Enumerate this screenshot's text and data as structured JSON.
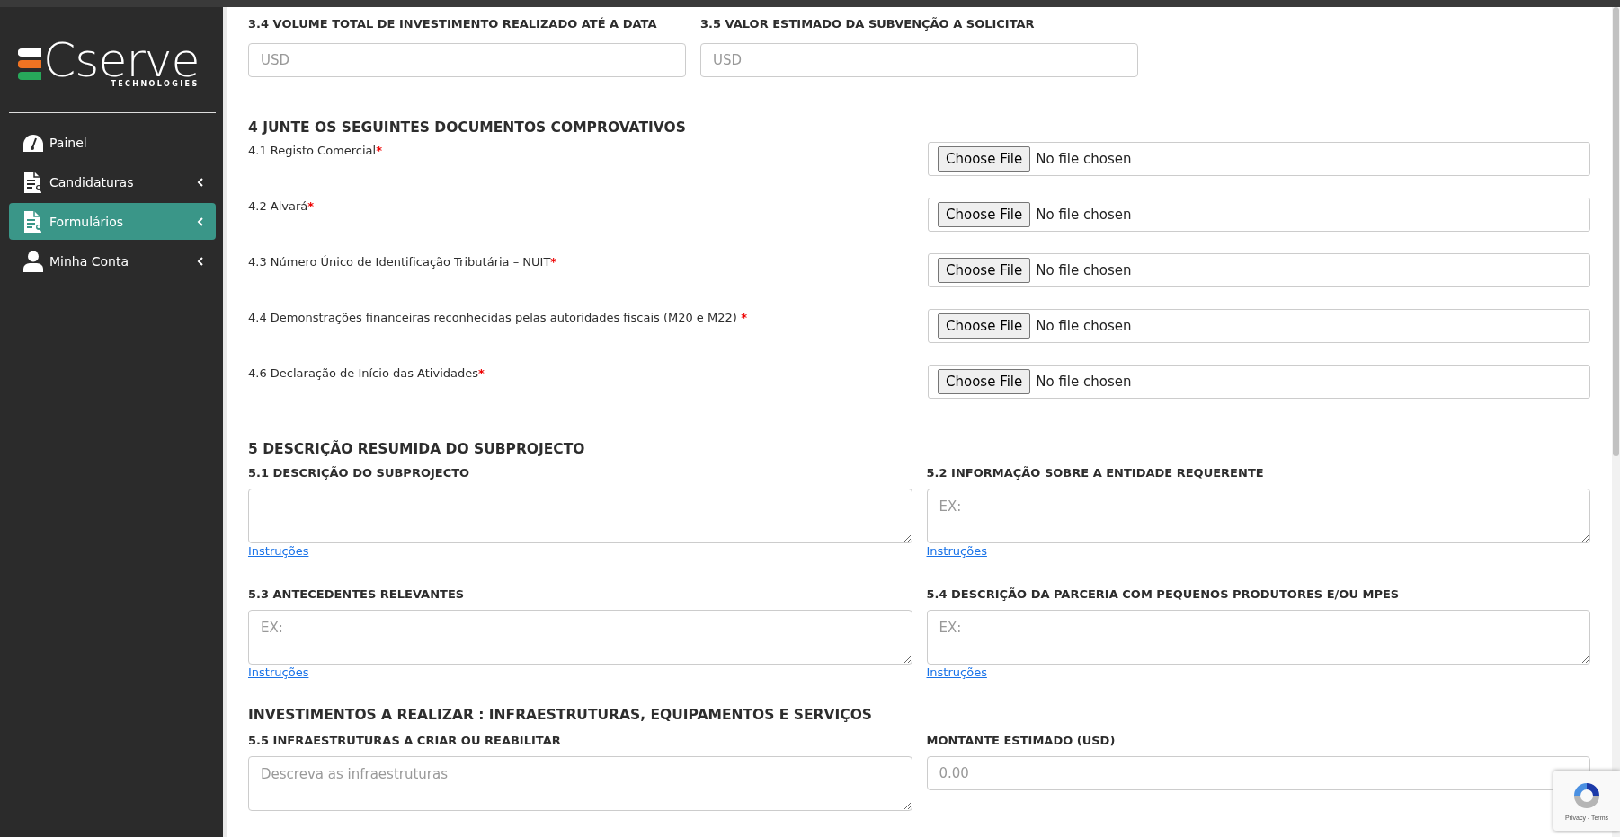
{
  "sidebar": {
    "logo": {
      "name": "Cserve",
      "tagline": "TECHNOLOGIES"
    },
    "items": [
      {
        "label": "Painel",
        "kind": "gauge",
        "selected": false,
        "has_submenu": false
      },
      {
        "label": "Candidaturas",
        "kind": "document",
        "selected": false,
        "has_submenu": true
      },
      {
        "label": "Formulários",
        "kind": "document",
        "selected": true,
        "has_submenu": true
      },
      {
        "label": "Minha Conta",
        "kind": "user",
        "selected": false,
        "has_submenu": true
      }
    ]
  },
  "investment_fields": [
    {
      "label": "3.4 VOLUME TOTAL DE INVESTIMENTO REALIZADO ATÉ A DATA",
      "placeholder": "USD"
    },
    {
      "label": "3.5 VALOR ESTIMADO DA SUBVENÇÃO A SOLICITAR",
      "placeholder": "USD"
    }
  ],
  "documents": {
    "heading": "4 JUNTE OS SEGUINTES DOCUMENTOS COMPROVATIVOS",
    "items": [
      {
        "label": "4.1 Registo Comercial",
        "required_mark": "*",
        "button": "Choose File",
        "status": "No file chosen"
      },
      {
        "label": "4.2 Alvará",
        "required_mark": "*",
        "button": "Choose File",
        "status": "No file chosen"
      },
      {
        "label": "4.3 Número Único de Identificação Tributária – NUIT",
        "required_mark": "*",
        "button": "Choose File",
        "status": "No file chosen"
      },
      {
        "label": "4.4 Demonstrações financeiras reconhecidas pelas autoridades fiscais (M20 e M22)",
        "required_mark": " *",
        "button": "Choose File",
        "status": "No file chosen"
      },
      {
        "label": "4.6 Declaração de Início das Atividades",
        "required_mark": "*",
        "button": "Choose File",
        "status": "No file chosen"
      }
    ]
  },
  "description": {
    "heading": "5 DESCRIÇÃO RESUMIDA DO SUBPROJECTO",
    "fields": [
      {
        "label": "5.1 DESCRIÇÃO DO SUBPROJECTO",
        "link": "Instruções"
      },
      {
        "label": "5.2 INFORMAÇÃO SOBRE A ENTIDADE REQUERENTE",
        "placeholder": "EX:",
        "link": "Instruções"
      },
      {
        "label": "5.3 ANTECEDENTES RELEVANTES",
        "placeholder": "EX:",
        "link": "Instruções"
      },
      {
        "label": "5.4 DESCRIÇÃO DA PARCERIA COM PEQUENOS PRODUTORES E/OU MPES",
        "placeholder": "EX:",
        "link": "Instruções"
      }
    ]
  },
  "investments": {
    "heading": "INVESTIMENTOS A REALIZAR : INFRAESTRUTURAS, EQUIPAMENTOS E SERVIÇOS",
    "fields": [
      {
        "kind": "textarea",
        "label": "5.5 INFRAESTRUTURAS A CRIAR OU REABILITAR",
        "placeholder": "Descreva as infraestruturas"
      },
      {
        "kind": "input",
        "label": "MONTANTE ESTIMADO (USD)",
        "placeholder": "0.00"
      }
    ]
  },
  "recaptcha": {
    "links": "Privacy - Terms"
  }
}
